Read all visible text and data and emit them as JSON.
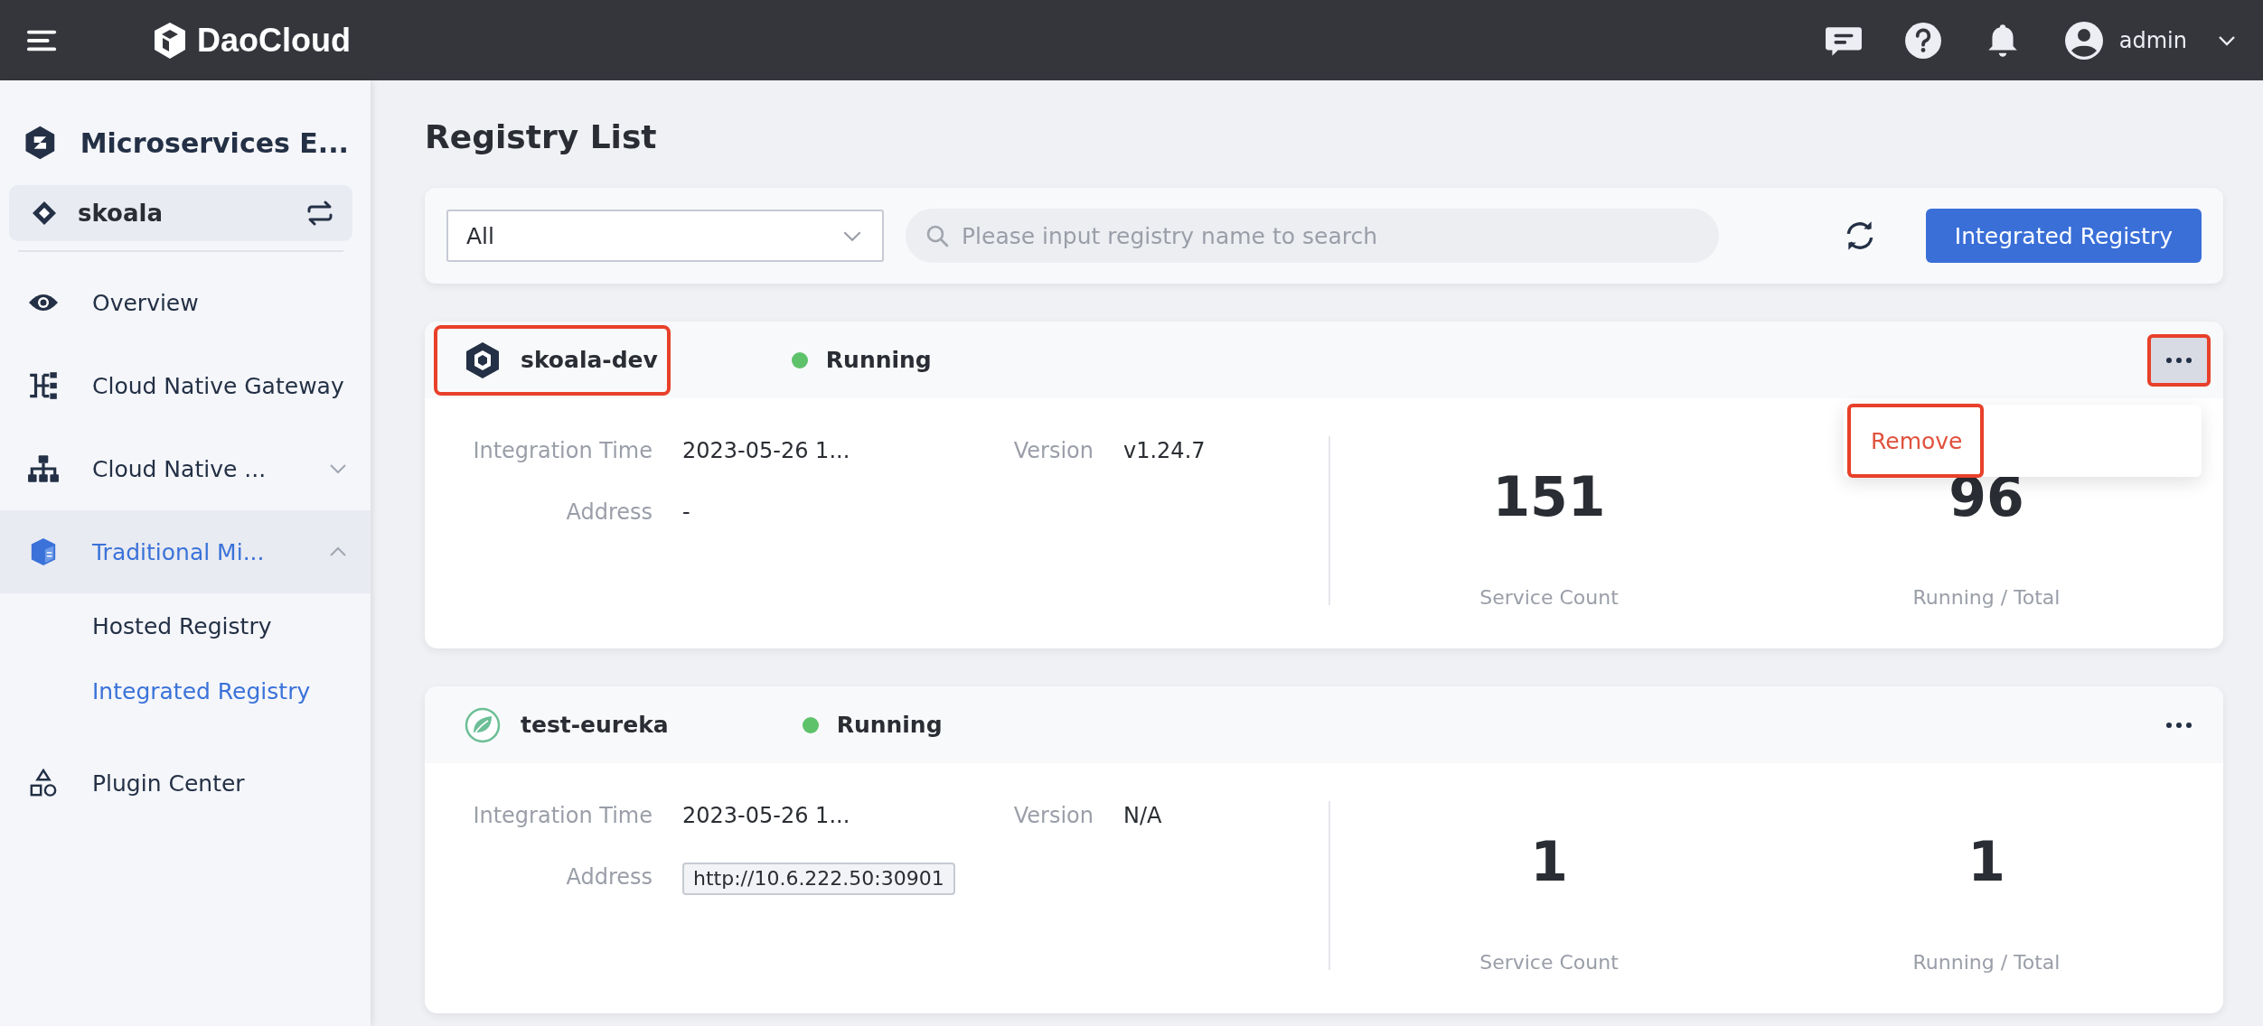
{
  "topbar": {
    "brand": "DaoCloud",
    "user": "admin"
  },
  "sidebar": {
    "product": "Microservices E...",
    "workspace": "skoala",
    "items": [
      {
        "label": "Overview",
        "selected": false
      },
      {
        "label": "Cloud Native Gateway",
        "selected": false
      },
      {
        "label": "Cloud Native ...",
        "selected": false,
        "expanded": false
      },
      {
        "label": "Traditional Mi...",
        "selected": true,
        "expanded": true,
        "children": [
          {
            "label": "Hosted Registry",
            "selected": false
          },
          {
            "label": "Integrated Registry",
            "selected": true
          }
        ]
      },
      {
        "label": "Plugin Center",
        "selected": false
      }
    ]
  },
  "page_title": "Registry List",
  "toolbar": {
    "filter": {
      "value": "All"
    },
    "search": {
      "placeholder": "Please input registry name to search"
    },
    "button": "Integrated Registry"
  },
  "registries": [
    {
      "name": "skoala-dev",
      "kind": "hexagon",
      "highlighted": true,
      "status": "Running",
      "running": true,
      "more_highlighted": true,
      "fields": [
        {
          "label": "Integration Time",
          "value": "2023-05-26 1...",
          "kind": "text"
        },
        {
          "label": "Version",
          "value": "v1.24.7",
          "kind": "text"
        },
        {
          "label": "Address",
          "value": "-",
          "kind": "text"
        }
      ],
      "stats": [
        {
          "value": "151",
          "label": "Service Count"
        },
        {
          "value": "96",
          "label": "Running / Total"
        }
      ],
      "menu": [
        {
          "label": "Remove",
          "highlighted": true
        }
      ]
    },
    {
      "name": "test-eureka",
      "kind": "leaf",
      "highlighted": false,
      "status": "Running",
      "running": true,
      "more_highlighted": false,
      "fields": [
        {
          "label": "Integration Time",
          "value": "2023-05-26 1...",
          "kind": "text"
        },
        {
          "label": "Version",
          "value": "N/A",
          "kind": "text"
        },
        {
          "label": "Address",
          "value": "http://10.6.222.50:30901",
          "kind": "tag"
        }
      ],
      "stats": [
        {
          "value": "1",
          "label": "Service Count"
        },
        {
          "value": "1",
          "label": "Running / Total"
        }
      ]
    }
  ]
}
